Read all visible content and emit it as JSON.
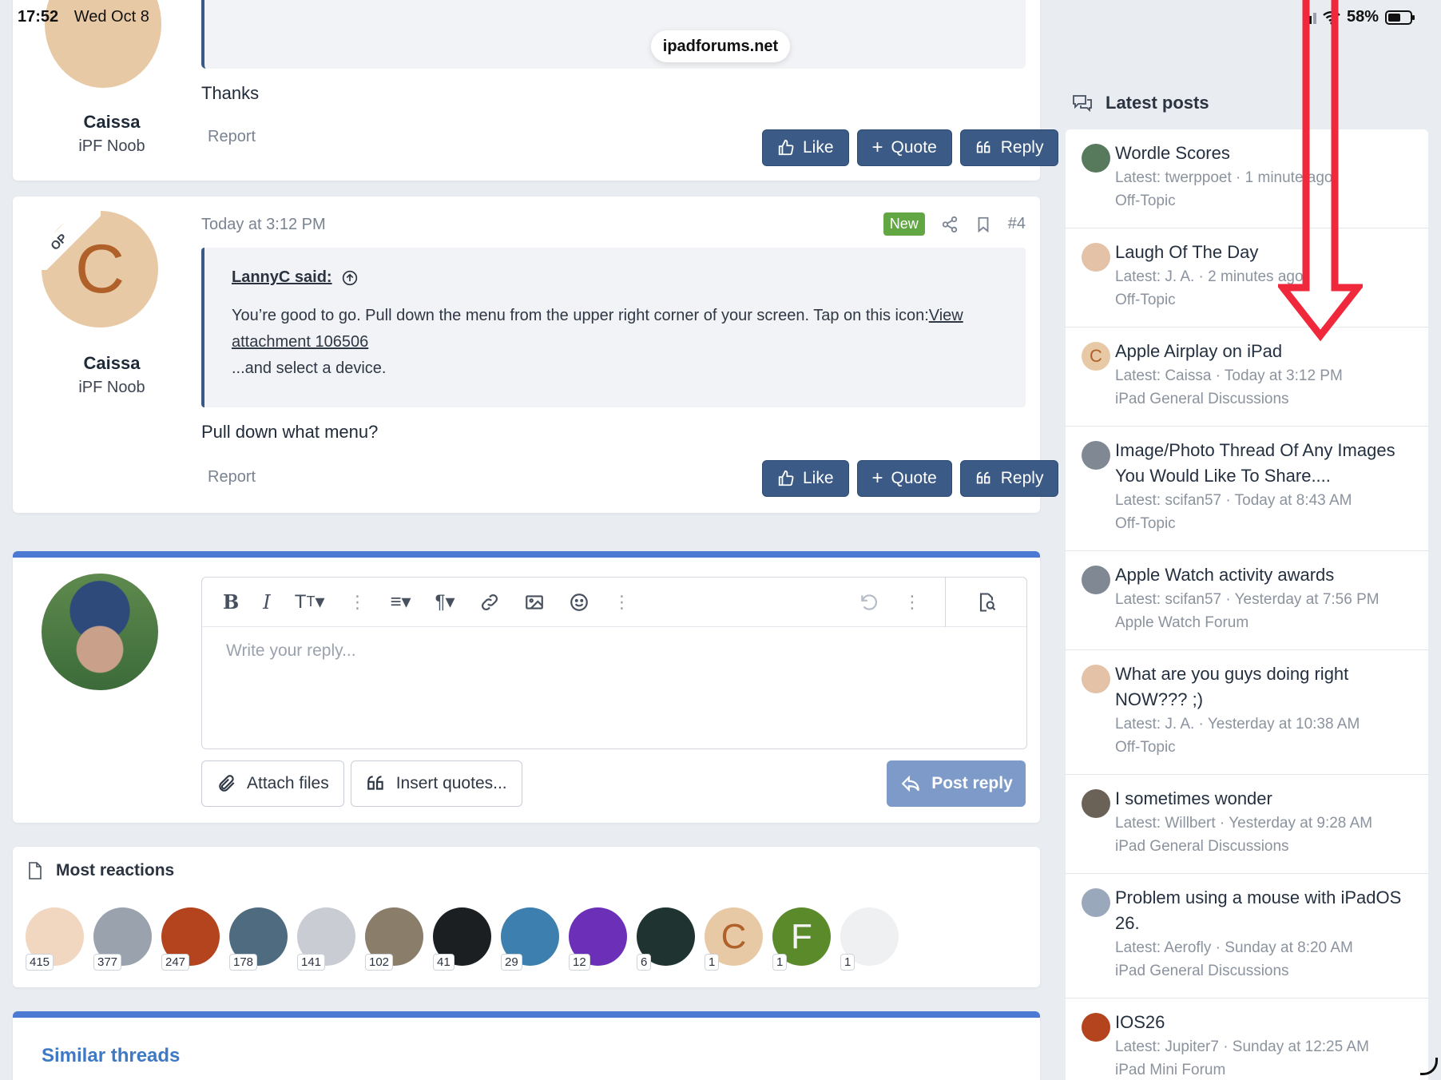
{
  "status_bar": {
    "time": "17:52",
    "date": "Wed Oct 8",
    "battery": "58%",
    "battery_level": 0.58
  },
  "browser": {
    "url": "ipadforums.net"
  },
  "post_prev": {
    "author": "Caissa",
    "author_title": "iPF Noob",
    "text": "Thanks",
    "report_label": "Report"
  },
  "post": {
    "author": "Caissa",
    "author_title": "iPF Noob",
    "avatar_letter": "C",
    "op_badge": "OP",
    "timestamp": "Today at 3:12 PM",
    "new_badge": "New",
    "post_number": "#4",
    "quote_author": "LannyC said:",
    "quote_line1": "You’re good to go. Pull down the menu from the upper right corner of your screen. Tap on this icon:",
    "quote_link1": "View",
    "quote_link2": "attachment 106506",
    "quote_line3": "...and select a device.",
    "text": "Pull down what menu?",
    "report_label": "Report"
  },
  "actions": {
    "like": "Like",
    "quote": "Quote",
    "reply": "Reply"
  },
  "editor": {
    "placeholder": "Write your reply...",
    "attach_files": "Attach files",
    "insert_quotes": "Insert quotes...",
    "post_reply": "Post reply"
  },
  "reactions": {
    "title": "Most reactions",
    "users": [
      {
        "count": "415",
        "color": "#f1d6c0"
      },
      {
        "count": "377",
        "color": "#9aa3ad"
      },
      {
        "count": "247",
        "color": "#b4441e"
      },
      {
        "count": "178",
        "color": "#4f6b7f"
      },
      {
        "count": "141",
        "color": "#c9cdd3"
      },
      {
        "count": "102",
        "color": "#8a7d6a"
      },
      {
        "count": "41",
        "color": "#1c1f22"
      },
      {
        "count": "29",
        "color": "#3d7fae"
      },
      {
        "count": "12",
        "color": "#6b2fb8"
      },
      {
        "count": "6",
        "color": "#1f3330"
      },
      {
        "count": "1",
        "color": "#e8c9a5",
        "letter": "C",
        "letter_color": "#b0612a"
      },
      {
        "count": "1",
        "color": "#5b8a2a",
        "letter": "F",
        "letter_color": "#f3f3f3"
      },
      {
        "count": "1",
        "color": "#eef0f2"
      }
    ]
  },
  "similar": {
    "title": "Similar threads"
  },
  "sidebar": {
    "title": "Latest posts",
    "items": [
      {
        "title": "Wordle Scores",
        "meta": "Latest: twerppoet · 1 minute ago",
        "forum": "Off-Topic",
        "avatar_color": "#587a5c"
      },
      {
        "title": "Laugh Of The Day",
        "meta": "Latest: J. A. · 2 minutes ago",
        "forum": "Off-Topic",
        "avatar_color": "#e3c2a8"
      },
      {
        "title": "Apple Airplay on iPad",
        "meta": "Latest: Caissa · Today at 3:12 PM",
        "forum": "iPad General Discussions",
        "avatar_color": "#e8c9a5",
        "avatar_letter": "C"
      },
      {
        "title": "Image/Photo Thread Of Any Images You Would Like To Share....",
        "meta": "Latest: scifan57 · Today at 8:43 AM",
        "forum": "Off-Topic",
        "avatar_color": "#7f8893"
      },
      {
        "title": "Apple Watch activity awards",
        "meta": "Latest: scifan57 · Yesterday at 7:56 PM",
        "forum": "Apple Watch Forum",
        "avatar_color": "#7f8893"
      },
      {
        "title": "What are you guys doing right NOW??? ;)",
        "meta": "Latest: J. A. · Yesterday at 10:38 AM",
        "forum": "Off-Topic",
        "avatar_color": "#e3c2a8"
      },
      {
        "title": "I sometimes wonder",
        "meta": "Latest: Willbert · Yesterday at 9:28 AM",
        "forum": "iPad General Discussions",
        "avatar_color": "#6b6257"
      },
      {
        "title": "Problem using a mouse with iPadOS 26.",
        "meta": "Latest: Aerofly · Sunday at 8:20 AM",
        "forum": "iPad General Discussions",
        "avatar_color": "#9aa8bb"
      },
      {
        "title": "IOS26",
        "meta": "Latest: Jupiter7 · Sunday at 12:25 AM",
        "forum": "iPad Mini Forum",
        "avatar_color": "#b4441e"
      }
    ]
  },
  "colors": {
    "accent": "#3b5a85",
    "annotation_arrow": "#f0283c",
    "new_badge": "#63a744",
    "link": "#3d79c4"
  }
}
